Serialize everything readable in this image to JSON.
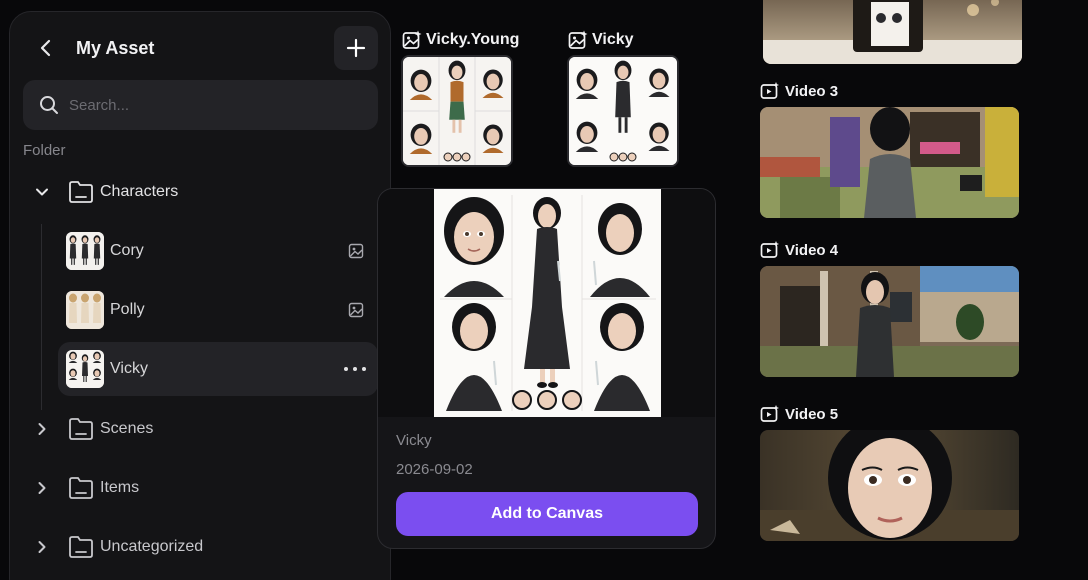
{
  "sidebar": {
    "title": "My Asset",
    "search_placeholder": "Search...",
    "section_label": "Folder",
    "folders": [
      {
        "label": "Characters",
        "expanded": true
      },
      {
        "label": "Scenes",
        "expanded": false
      },
      {
        "label": "Items",
        "expanded": false
      },
      {
        "label": "Uncategorized",
        "expanded": false
      }
    ],
    "characters": [
      {
        "label": "Cory",
        "icon": "image-icon"
      },
      {
        "label": "Polly",
        "icon": "image-icon"
      },
      {
        "label": "Vicky",
        "icon": "more-icon",
        "selected": true
      }
    ]
  },
  "assets": [
    {
      "title": "Vicky.Young",
      "icon": "image-sparkle-icon"
    },
    {
      "title": "Vicky",
      "icon": "image-sparkle-icon"
    }
  ],
  "popover": {
    "name": "Vicky",
    "date": "2026-09-02",
    "button_label": "Add to Canvas"
  },
  "videos": [
    {
      "label": "Video 3",
      "icon": "video-sparkle-icon"
    },
    {
      "label": "Video 4",
      "icon": "video-sparkle-icon"
    },
    {
      "label": "Video 5",
      "icon": "video-sparkle-icon"
    }
  ],
  "colors": {
    "accent": "#7b4ef0",
    "background": "#08080a",
    "panel": "#141416"
  }
}
